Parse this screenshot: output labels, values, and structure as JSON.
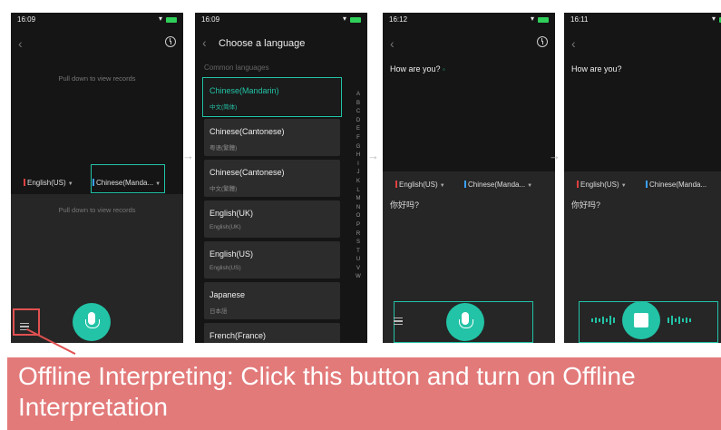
{
  "screen1": {
    "time": "16:09",
    "hint_top": "Pull down to view records",
    "hint_bottom": "Pull down to view records",
    "lang_left": "English(US)",
    "lang_right": "Chinese(Manda..."
  },
  "screen2": {
    "time": "16:09",
    "title": "Choose a language",
    "section": "Common languages",
    "items": [
      {
        "name": "Chinese(Mandarin)",
        "sub": "中文(简体)"
      },
      {
        "name": "Chinese(Cantonese)",
        "sub": "粤语(繁體)"
      },
      {
        "name": "Chinese(Cantonese)",
        "sub": "中文(繁體)"
      },
      {
        "name": "English(UK)",
        "sub": "English(UK)"
      },
      {
        "name": "English(US)",
        "sub": "English(US)"
      },
      {
        "name": "Japanese",
        "sub": "日本語"
      },
      {
        "name": "French(France)",
        "sub": ""
      }
    ],
    "alphabet": [
      "A",
      "B",
      "C",
      "D",
      "E",
      "F",
      "G",
      "H",
      "I",
      "J",
      "K",
      "L",
      "M",
      "N",
      "O",
      "P",
      "R",
      "S",
      "T",
      "U",
      "V",
      "W"
    ]
  },
  "screen3": {
    "time": "16:12",
    "english": "How are you?",
    "chinese": "你好吗?",
    "lang_left": "English(US)",
    "lang_right": "Chinese(Manda..."
  },
  "screen4": {
    "time": "16:11",
    "english": "How are you?",
    "chinese": "你好吗?",
    "lang_left": "English(US)",
    "lang_right": "Chinese(Manda..."
  },
  "banner": {
    "text": "Offline Interpreting: Click this button and turn on Offline Interpretation",
    "color": "#e37a7a"
  },
  "colors": {
    "accent": "#22c3a6",
    "highlight_red": "#e05050"
  },
  "icons": [
    "back-arrow-icon",
    "history-icon",
    "menu-icon",
    "microphone-icon",
    "stop-icon",
    "speaker-icon"
  ]
}
